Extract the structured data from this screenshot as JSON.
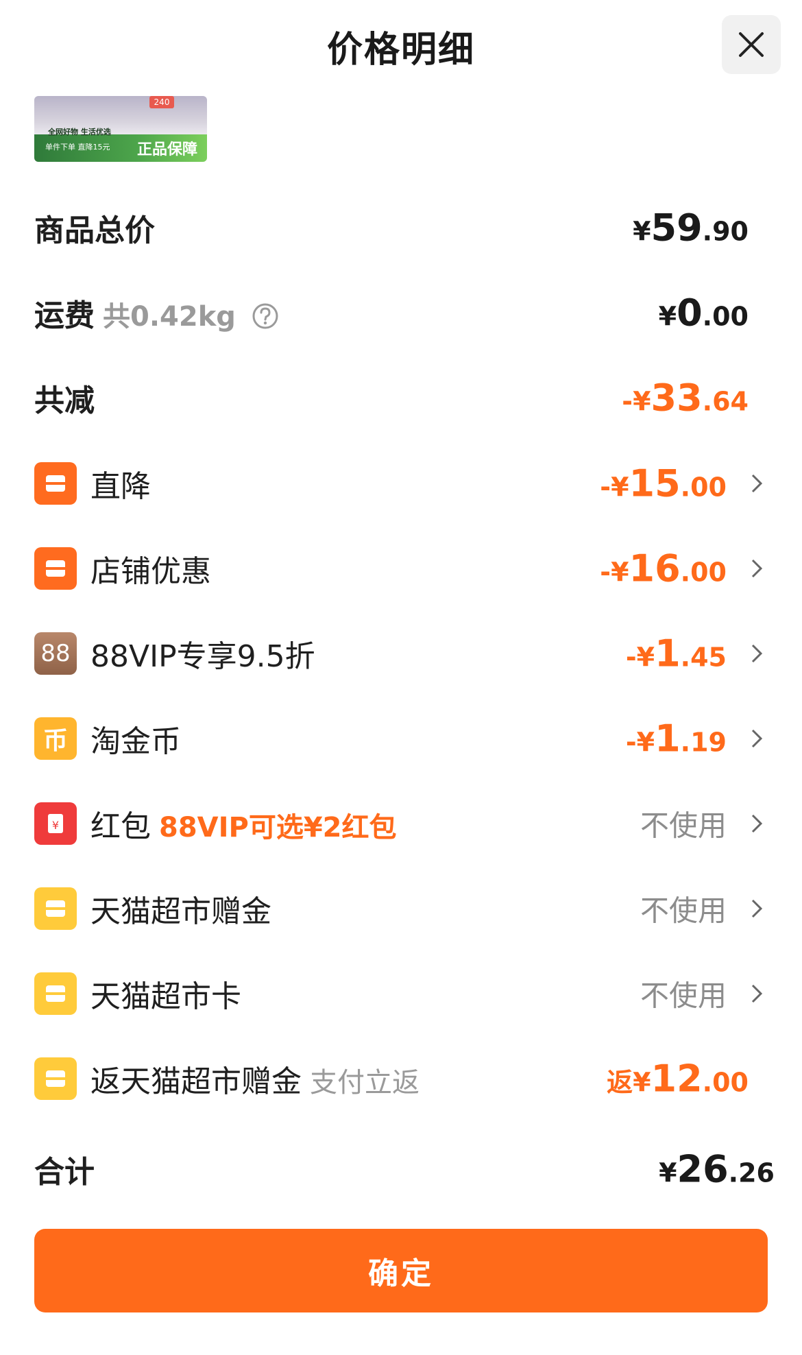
{
  "header": {
    "title": "价格明细"
  },
  "banner": {
    "badge": "240",
    "top_line": "全网好物 生活优选",
    "bottom_line": "单件下单 直降15元",
    "guarantee": "正品保障"
  },
  "rows": {
    "total_price": {
      "label": "商品总价",
      "yen": "¥",
      "int": "59",
      "dec": ".90"
    },
    "shipping": {
      "label": "运费",
      "weight": "共0.42kg",
      "yen": "¥",
      "int": "0",
      "dec": ".00"
    },
    "discount_total": {
      "label": "共减",
      "yen": "-¥",
      "int": "33",
      "dec": ".64"
    },
    "direct_cut": {
      "label": "直降",
      "yen": "-¥",
      "int": "15",
      "dec": ".00",
      "icon": "shop-icon"
    },
    "store_coupon": {
      "label": "店铺优惠",
      "yen": "-¥",
      "int": "16",
      "dec": ".00",
      "icon": "shop-icon"
    },
    "vip": {
      "label": "88VIP专享9.5折",
      "icon_text": "88",
      "yen": "-¥",
      "int": "1",
      "dec": ".45"
    },
    "coins": {
      "label": "淘金币",
      "icon_text": "币",
      "yen": "-¥",
      "int": "1",
      "dec": ".19"
    },
    "red_packet": {
      "label": "红包",
      "promo": "88VIP可选¥2红包",
      "icon_text": "¥",
      "value": "不使用"
    },
    "gift_money": {
      "label": "天猫超市赠金",
      "value": "不使用",
      "icon": "ticket-icon"
    },
    "market_card": {
      "label": "天猫超市卡",
      "value": "不使用",
      "icon": "ticket-icon"
    },
    "cashback": {
      "label": "返天猫超市赠金",
      "sub": "支付立返",
      "yen": "返¥",
      "int": "12",
      "dec": ".00",
      "icon": "ticket-icon"
    },
    "sum": {
      "label": "合计",
      "yen": "¥",
      "int": "26",
      "dec": ".26"
    }
  },
  "footer": {
    "confirm_label": "确定"
  },
  "colors": {
    "accent": "#ff6a1a",
    "vip_brown": "#a77659",
    "gold": "#ffb52e",
    "red": "#ef3b3b",
    "yellow": "#ffcb3b"
  }
}
